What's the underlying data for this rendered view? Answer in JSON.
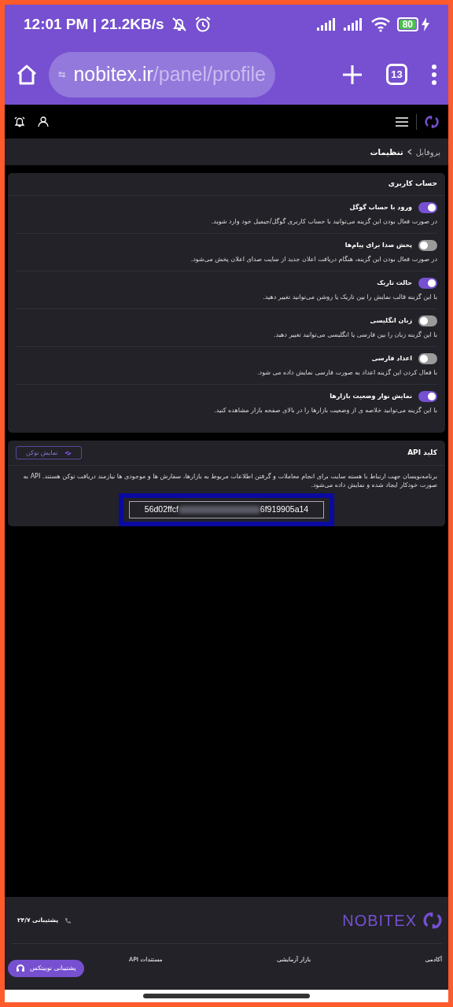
{
  "status_bar": {
    "time_speed": "12:01 PM | 21.2KB/s",
    "battery": "80"
  },
  "browser": {
    "url_host": "nobitex.ir",
    "url_path": "/panel/profile",
    "tabs_count": "13"
  },
  "breadcrumb": [
    {
      "label": "پروفایل",
      "selected": false
    },
    {
      "label": "تنظیمات",
      "selected": true
    }
  ],
  "account_card": {
    "title": "حساب کاربری",
    "settings": [
      {
        "label": "ورود با حساب گوگل",
        "on": true,
        "description": "در صورت فعال بودن این گزینه می‌توانید با حساب کاربری گوگل/جیمیل خود وارد شوید."
      },
      {
        "label": "پخش صدا برای پیام‌ها",
        "on": false,
        "description": "در صورت فعال بودن این گزینه، هنگام دریافت اعلان جدید از سایت صدای اعلان پخش می‌شود."
      },
      {
        "label": "حالت تاریک",
        "on": true,
        "description": "با این گزینه قالب نمایش را بین تاریک یا روشن می‌توانید تغییر دهید."
      },
      {
        "label": "زبان انگلیسی",
        "on": false,
        "description": "با این گزینه زبان را بین فارسی یا انگلیسی می‌توانید تغییر دهید."
      },
      {
        "label": "اعداد فارسی",
        "on": false,
        "description": "با فعال کردن این گزینه اعداد به صورت فارسی نمایش داده می شود."
      },
      {
        "label": "نمایش نوار وضعیت بازارها",
        "on": true,
        "description": "با این گزینه می‌توانید خلاصه ی از وضعیت بازارها را در بالای صفحه بازار مشاهده کنید."
      }
    ]
  },
  "api_card": {
    "title": "کلید API",
    "show_token_button": "نمایش توکن",
    "description": "برنامه‌نویسان جهت ارتباط با هسته سایت برای انجام معاملات و گرفتن اطلاعات مربوط به بازارها، سفارش ها و موجودی ها نیازمند دریافت توکن هستند. API به صورت خودکار ایجاد شده و نمایش داده می‌شود.",
    "key_start": "56d02ffcf",
    "key_end": "6f919905a14"
  },
  "footer": {
    "logo": "NOBITEX",
    "support_phone": "پشتیبانی ۲۴/۷",
    "links": [
      "آکادمی",
      "بازار آزمایشی",
      "مستندات API"
    ],
    "support_button": "پشتیبانی نوبیتکس"
  }
}
